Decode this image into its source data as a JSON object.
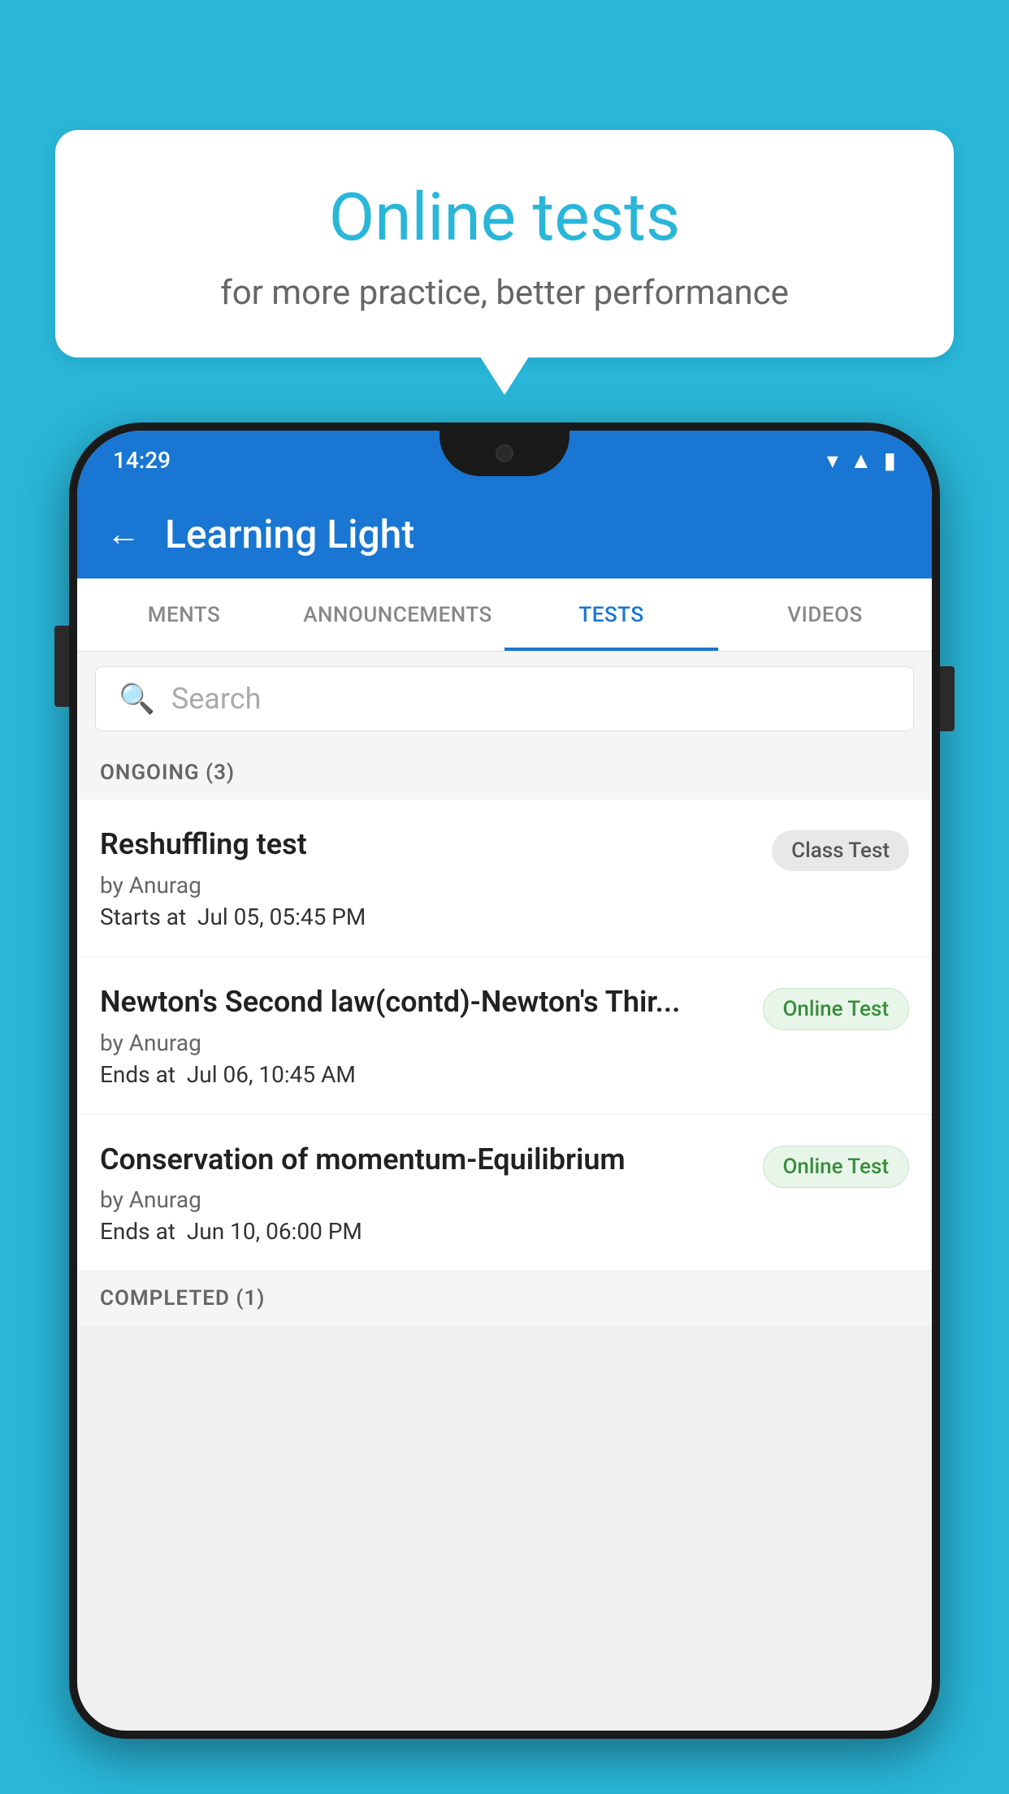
{
  "background": {
    "color": "#29B6D8"
  },
  "speech_bubble": {
    "title": "Online tests",
    "subtitle": "for more practice, better performance"
  },
  "status_bar": {
    "time": "14:29",
    "icons": [
      "wifi",
      "signal",
      "battery"
    ]
  },
  "app_bar": {
    "back_label": "←",
    "title": "Learning Light"
  },
  "tabs": [
    {
      "label": "MENTS",
      "active": false
    },
    {
      "label": "ANNOUNCEMENTS",
      "active": false
    },
    {
      "label": "TESTS",
      "active": true
    },
    {
      "label": "VIDEOS",
      "active": false
    }
  ],
  "search": {
    "placeholder": "Search"
  },
  "ongoing_section": {
    "label": "ONGOING (3)"
  },
  "tests": [
    {
      "name": "Reshuffling test",
      "author": "by Anurag",
      "time_label": "Starts at",
      "time_value": "Jul 05, 05:45 PM",
      "badge": "Class Test",
      "badge_type": "class"
    },
    {
      "name": "Newton's Second law(contd)-Newton's Thir...",
      "author": "by Anurag",
      "time_label": "Ends at",
      "time_value": "Jul 06, 10:45 AM",
      "badge": "Online Test",
      "badge_type": "online"
    },
    {
      "name": "Conservation of momentum-Equilibrium",
      "author": "by Anurag",
      "time_label": "Ends at",
      "time_value": "Jun 10, 06:00 PM",
      "badge": "Online Test",
      "badge_type": "online"
    }
  ],
  "completed_section": {
    "label": "COMPLETED (1)"
  }
}
